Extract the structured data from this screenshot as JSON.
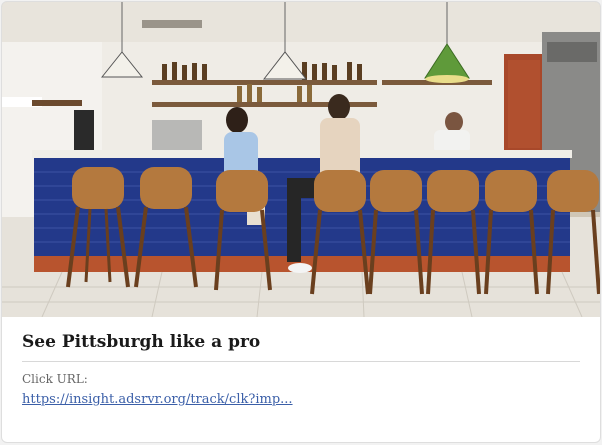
{
  "card": {
    "image_alt": "Restaurant bar with people seated on stools",
    "title": "See Pittsburgh like a pro",
    "click_url_label": "Click URL:",
    "click_url": "https://insight.adsrvr.org/track/clk?imp...",
    "colors": {
      "link": "#3b5fa8",
      "title": "#1a1a1a",
      "label": "#666666",
      "bar_tile": "#23398a"
    }
  }
}
